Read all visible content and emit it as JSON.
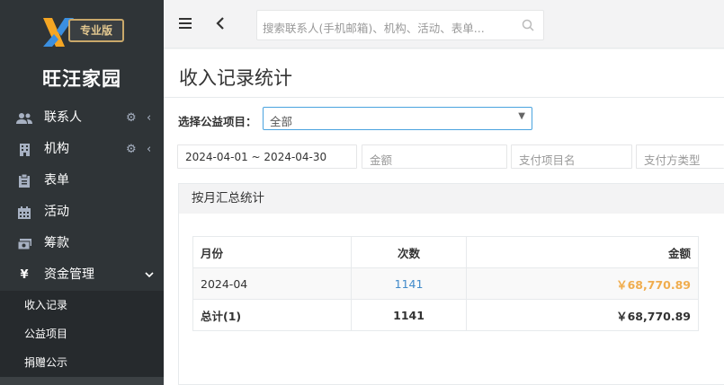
{
  "sidebar": {
    "badge": "专业版",
    "app_name": "旺汪家园",
    "items": [
      {
        "label": "联系人",
        "icon": "users-icon"
      },
      {
        "label": "机构",
        "icon": "building-icon"
      },
      {
        "label": "表单",
        "icon": "clipboard-icon"
      },
      {
        "label": "活动",
        "icon": "calendar-icon"
      },
      {
        "label": "筹款",
        "icon": "money-icon"
      },
      {
        "label": "资金管理",
        "icon": "yen-icon"
      }
    ],
    "sub_items": [
      "收入记录",
      "公益项目",
      "捐赠公示"
    ],
    "icon_glyphs": {
      "yen": "¥"
    }
  },
  "topbar": {
    "search_placeholder": "搜索联系人(手机邮箱)、机构、活动、表单..."
  },
  "page": {
    "title": "收入记录统计",
    "project_label": "选择公益项目：",
    "project_value": "全部",
    "filters": {
      "date_range": "2024-04-01 ~ 2024-04-30",
      "amount_placeholder": "金额",
      "item_placeholder": "支付项目名",
      "type_placeholder": "支付方类型"
    },
    "panel_title": "按月汇总统计",
    "table": {
      "headers": [
        "月份",
        "次数",
        "金额"
      ],
      "rows": [
        {
          "month": "2024-04",
          "count": "1141",
          "amount": "￥68,770.89"
        }
      ],
      "total": {
        "label": "总计(1)",
        "count": "1141",
        "amount": "￥68,770.89"
      }
    }
  },
  "colors": {
    "sidebar_bg": "#2f3437",
    "accent_blue": "#4aa3df",
    "link_blue": "#428bca",
    "amount_orange": "#f0ad4e",
    "badge_gold": "#c9a86a"
  }
}
